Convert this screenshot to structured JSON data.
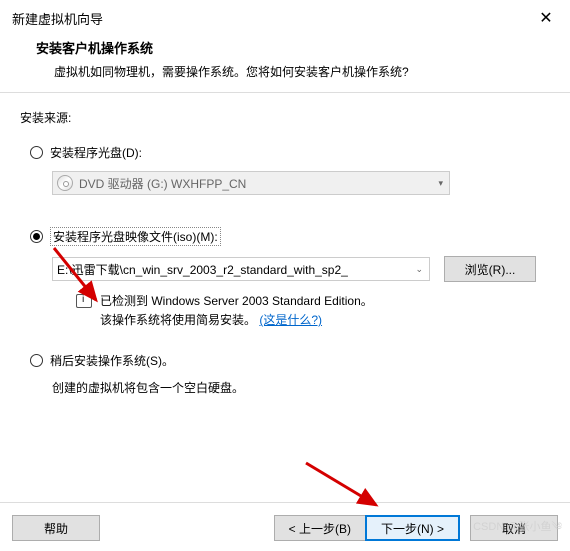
{
  "titlebar": {
    "title": "新建虚拟机向导",
    "close": "✕"
  },
  "header": {
    "title": "安装客户机操作系统",
    "desc": "虚拟机如同物理机，需要操作系统。您将如何安装客户机操作系统?"
  },
  "source_label": "安装来源:",
  "option_disc": {
    "label": "安装程序光盘(D):",
    "dvd": "DVD 驱动器 (G:) WXHFPP_CN"
  },
  "option_iso": {
    "label": "安装程序光盘映像文件(iso)(M):",
    "path": "E:\\迅雷下载\\cn_win_srv_2003_r2_standard_with_sp2_",
    "browse": "浏览(R)...",
    "info_line1": "已检测到 Windows Server 2003 Standard Edition。",
    "info_line2_a": "该操作系统将使用简易安装。",
    "info_link": "(这是什么?)"
  },
  "option_later": {
    "label": "稍后安装操作系统(S)。",
    "desc": "创建的虚拟机将包含一个空白硬盘。"
  },
  "footer": {
    "help": "帮助",
    "back": "< 上一步(B)",
    "next": "下一步(N) >",
    "cancel": "取消"
  },
  "watermark": "CSDN @张小鱼༄"
}
